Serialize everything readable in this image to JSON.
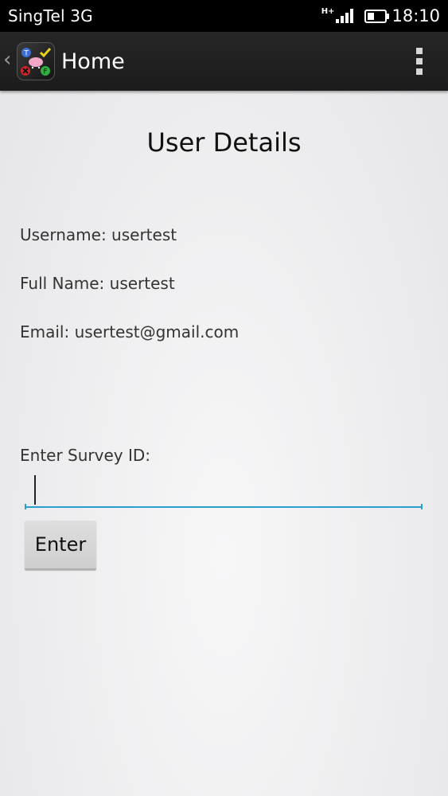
{
  "status_bar": {
    "carrier": "SingTel 3G",
    "network_type": "H+",
    "signal_bars": 4,
    "battery_level": 0.4,
    "time": "18:10"
  },
  "action_bar": {
    "up_icon": "chevron-left-icon",
    "app_icon": "survey-app-icon",
    "title": "Home",
    "overflow_icon": "more-vertical-icon"
  },
  "main": {
    "title": "User Details",
    "username": "Username: usertest",
    "full_name": "Full Name: usertest",
    "email": "Email: usertest@gmail.com",
    "survey_label": "Enter Survey ID:",
    "survey_input_value": "",
    "enter_label": "Enter"
  },
  "colors": {
    "accent": "#2a9fc9",
    "action_bar": "#222222",
    "status_bar": "#000000"
  }
}
